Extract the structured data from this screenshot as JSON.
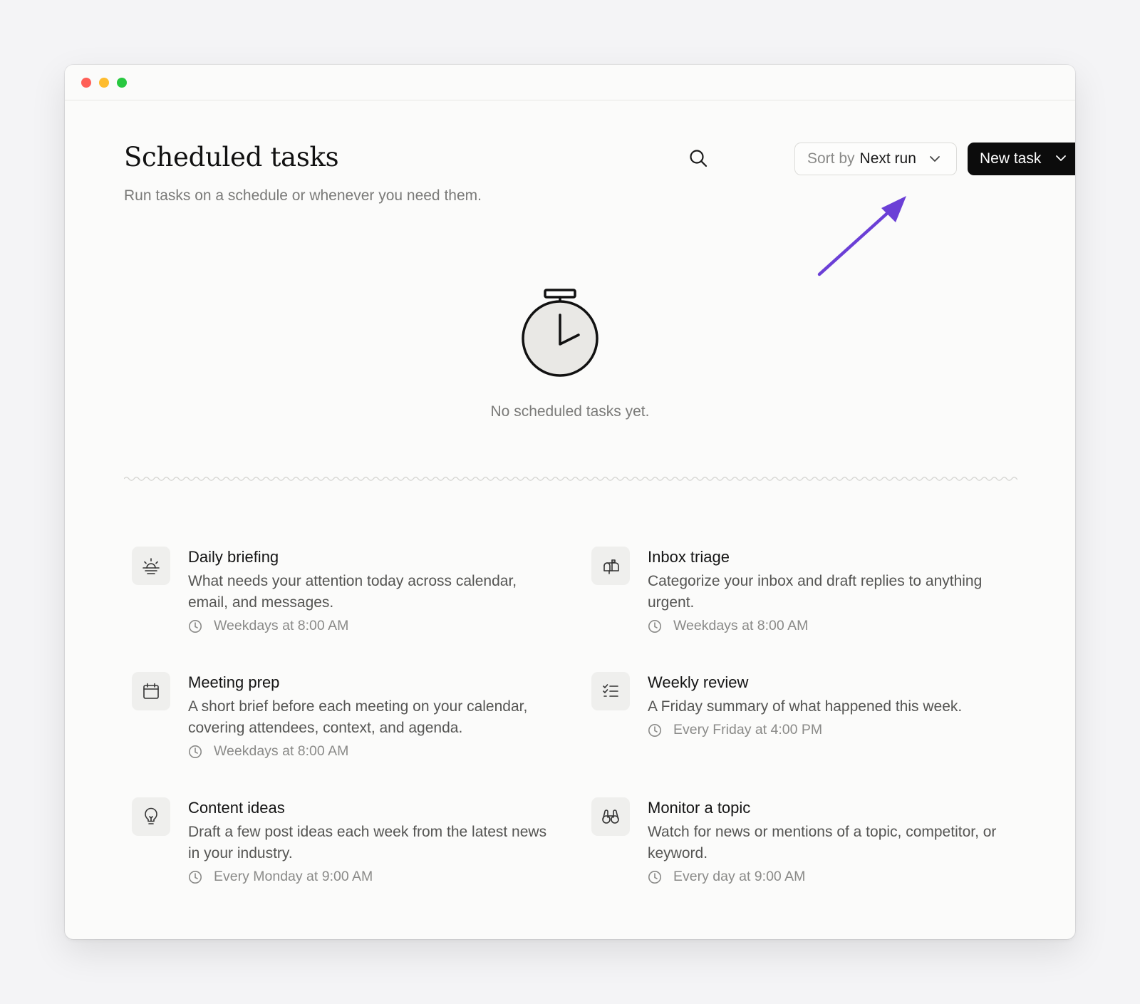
{
  "header": {
    "title": "Scheduled tasks",
    "subtitle": "Run tasks on a schedule or whenever you need them."
  },
  "toolbar": {
    "search_icon": "search-icon",
    "sort_prefix": "Sort by",
    "sort_value": "Next run",
    "new_task_label": "New task"
  },
  "empty_state": {
    "icon": "stopwatch-icon",
    "message": "No scheduled tasks yet."
  },
  "annotation": {
    "arrow_color": "#6b3fd6"
  },
  "templates": [
    {
      "icon": "sunrise-icon",
      "title": "Daily briefing",
      "description": "What needs your attention today across calendar, email, and messages.",
      "schedule": "Weekdays at 8:00 AM"
    },
    {
      "icon": "mailbox-icon",
      "title": "Inbox triage",
      "description": "Categorize your inbox and draft replies to anything urgent.",
      "schedule": "Weekdays at 8:00 AM"
    },
    {
      "icon": "calendar-icon",
      "title": "Meeting prep",
      "description": "A short brief before each meeting on your calendar, covering attendees, context, and agenda.",
      "schedule": "Weekdays at 8:00 AM"
    },
    {
      "icon": "checklist-icon",
      "title": "Weekly review",
      "description": "A Friday summary of what happened this week.",
      "schedule": "Every Friday at 4:00 PM"
    },
    {
      "icon": "lightbulb-icon",
      "title": "Content ideas",
      "description": "Draft a few post ideas each week from the latest news in your industry.",
      "schedule": "Every Monday at 9:00 AM"
    },
    {
      "icon": "binoculars-icon",
      "title": "Monitor a topic",
      "description": "Watch for news or mentions of a topic, competitor, or keyword.",
      "schedule": "Every day at 9:00 AM"
    }
  ]
}
